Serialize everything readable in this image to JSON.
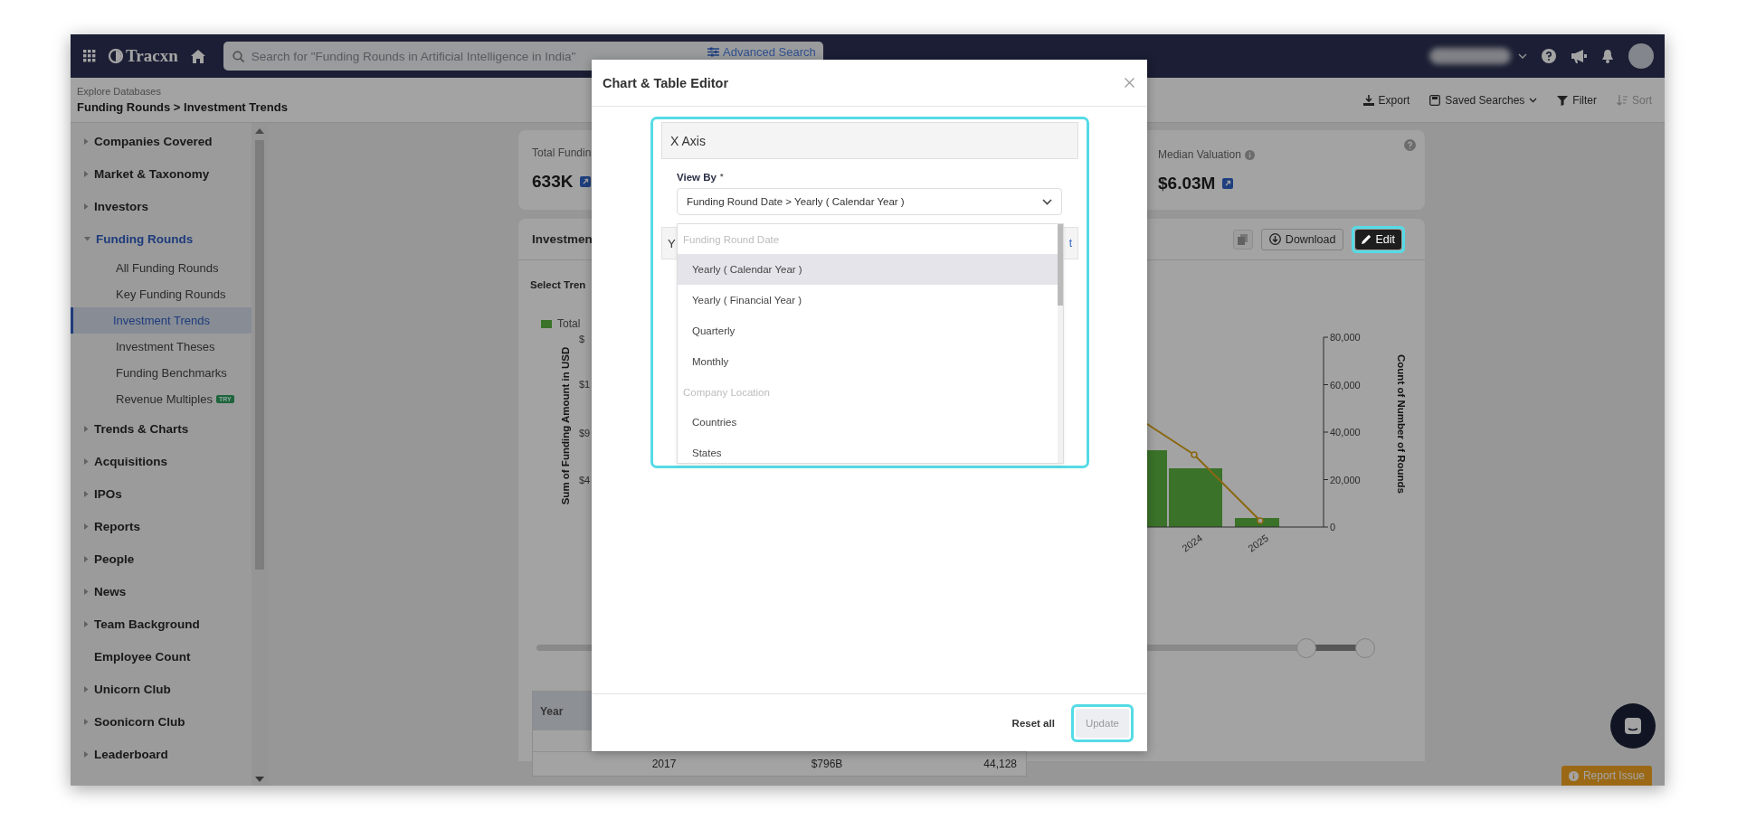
{
  "topbar": {
    "logo": "Tracxn",
    "search_placeholder": "Search for \"Funding Rounds in Artificial Intelligence in India\"",
    "advanced_search": "Advanced Search"
  },
  "breadcrumb": {
    "parent": "Explore Databases",
    "path": "Funding Rounds > Investment Trends"
  },
  "toolbar": [
    {
      "label": "Export",
      "kind": "export",
      "disabled": false
    },
    {
      "label": "Saved Searches",
      "kind": "saved",
      "disabled": false
    },
    {
      "label": "Filter",
      "kind": "filter",
      "disabled": false
    },
    {
      "label": "Sort",
      "kind": "sort",
      "disabled": true
    }
  ],
  "sidebar": {
    "items": [
      {
        "label": "Companies Covered",
        "expandable": true,
        "expanded": false,
        "active": false
      },
      {
        "label": "Market & Taxonomy",
        "expandable": true,
        "expanded": false,
        "active": false
      },
      {
        "label": "Investors",
        "expandable": true,
        "expanded": false,
        "active": false
      },
      {
        "label": "Funding Rounds",
        "expandable": true,
        "expanded": true,
        "active": true,
        "children": [
          {
            "label": "All Funding Rounds",
            "selected": false
          },
          {
            "label": "Key Funding Rounds",
            "selected": false
          },
          {
            "label": "Investment Trends",
            "selected": true
          },
          {
            "label": "Investment Theses",
            "selected": false
          },
          {
            "label": "Funding Benchmarks",
            "selected": false
          },
          {
            "label": "Revenue Multiples",
            "selected": false,
            "badge": "TRY"
          }
        ]
      },
      {
        "label": "Trends & Charts",
        "expandable": true,
        "expanded": false,
        "active": false
      },
      {
        "label": "Acquisitions",
        "expandable": true,
        "expanded": false,
        "active": false
      },
      {
        "label": "IPOs",
        "expandable": true,
        "expanded": false,
        "active": false
      },
      {
        "label": "Reports",
        "expandable": true,
        "expanded": false,
        "active": false
      },
      {
        "label": "People",
        "expandable": true,
        "expanded": false,
        "active": false
      },
      {
        "label": "News",
        "expandable": true,
        "expanded": false,
        "active": false
      },
      {
        "label": "Team Background",
        "expandable": true,
        "expanded": false,
        "active": false
      },
      {
        "label": "Employee Count",
        "expandable": false,
        "expanded": false,
        "active": false
      },
      {
        "label": "Unicorn Club",
        "expandable": true,
        "expanded": false,
        "active": false
      },
      {
        "label": "Soonicorn Club",
        "expandable": true,
        "expanded": false,
        "active": false
      },
      {
        "label": "Leaderboard",
        "expandable": true,
        "expanded": false,
        "active": false
      }
    ]
  },
  "stats": [
    {
      "label": "Total Fundin",
      "value": "633K"
    },
    {
      "label": "Median Valuation",
      "value": "$6.03M"
    }
  ],
  "panel": {
    "title": "Investmen",
    "download": "Download",
    "edit": "Edit",
    "select_trend": "Select Tren",
    "legend": "Total",
    "chart": {
      "y_title": "Sum of Funding Amount in USD",
      "y_ticks": [
        "$",
        "$1",
        "$9",
        "$4"
      ],
      "y2_title": "Count of Number of Rounds",
      "y2_ticks": [
        "80,000",
        "60,000",
        "40,000",
        "20,000",
        "0"
      ],
      "x_labels": [
        "2024",
        "2025"
      ]
    }
  },
  "slider": {
    "handles": [
      {
        "level": 0.92
      },
      {
        "level": 0.99
      }
    ]
  },
  "table": {
    "columns": [
      "Year"
    ],
    "rows": [
      {
        "cells": [
          "2017",
          "$796B",
          "44,128"
        ]
      }
    ]
  },
  "modal": {
    "title": "Chart & Table Editor",
    "section": "X Axis",
    "view_by_label": "View By",
    "required_mark": "*",
    "view_by_value": "Funding Round Date > Yearly ( Calendar Year )",
    "behind_label": "Y",
    "behind_link": "t",
    "options": [
      {
        "kind": "group",
        "label": "Funding Round Date"
      },
      {
        "kind": "option",
        "label": "Yearly ( Calendar Year )",
        "selected": true
      },
      {
        "kind": "option",
        "label": "Yearly ( Financial Year )",
        "selected": false
      },
      {
        "kind": "option",
        "label": "Quarterly",
        "selected": false
      },
      {
        "kind": "option",
        "label": "Monthly",
        "selected": false
      },
      {
        "kind": "group",
        "label": "Company Location"
      },
      {
        "kind": "option",
        "label": "Countries",
        "selected": false
      },
      {
        "kind": "option",
        "label": "States",
        "selected": false
      }
    ],
    "reset": "Reset all",
    "update": "Update",
    "update_disabled": true
  },
  "report_issue": "Report Issue"
}
